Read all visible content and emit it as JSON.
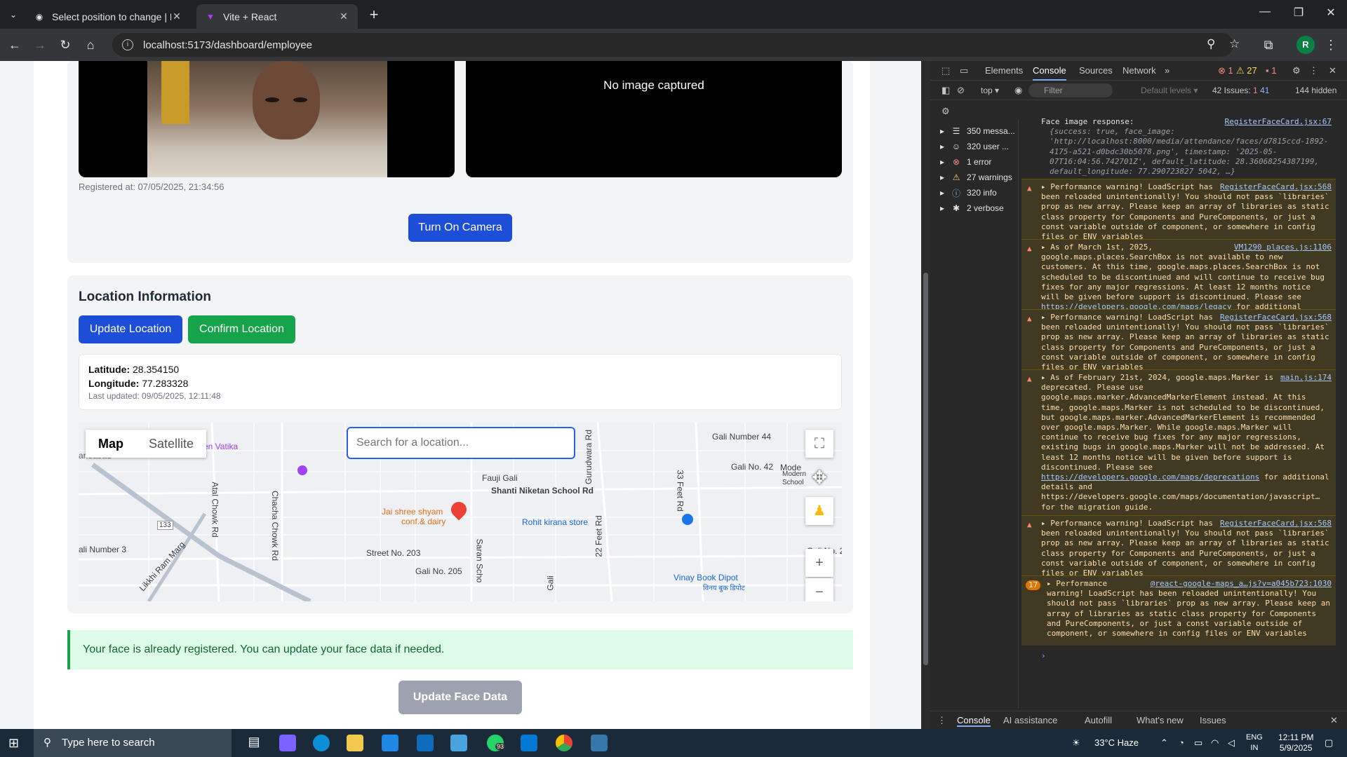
{
  "browser": {
    "tabs": [
      {
        "title": "Select position to change | Djan",
        "active": false
      },
      {
        "title": "Vite + React",
        "active": true
      }
    ],
    "url": "localhost:5173/dashboard/employee",
    "profile_initial": "R"
  },
  "camera": {
    "right_placeholder": "No image captured",
    "registered_at": "Registered at: 07/05/2025, 21:34:56",
    "turn_on_label": "Turn On Camera"
  },
  "location": {
    "title": "Location Information",
    "update_label": "Update Location",
    "confirm_label": "Confirm Location",
    "latitude_label": "Latitude:",
    "latitude_value": "28.354150",
    "longitude_label": "Longitude:",
    "longitude_value": "77.283328",
    "last_updated": "Last updated: 09/05/2025, 12:11:48"
  },
  "map": {
    "type_map": "Map",
    "type_satellite": "Satellite",
    "search_placeholder": "Search for a location...",
    "labels": {
      "gali44": "Gali Number 44",
      "gali42": "Gali No. 42",
      "fauji": "Fauji Gali",
      "shanti": "Shanti Niketan School Rd",
      "jai1": "Jai shree shyam",
      "jai2": "conf.& dairy",
      "rohit": "Rohit kirana store",
      "street203": "Street No. 203",
      "gali205": "Gali No. 205",
      "gali3": "ali Number 3",
      "vinay": "Vinay Book Dipot",
      "vatika": "en Vatika",
      "atal": "Atal Chowk Rd",
      "chacha": "Chacha Chowk Rd",
      "gurudwara": "Gurudwara Rd",
      "saran": "Saran Scho",
      "feet22": "22 Feet Rd",
      "feet33": "33 Feet Rd",
      "likkhi": "Likkhi Ram Marg",
      "route": "133",
      "gali20": "Gali No. 20",
      "mode": "Mode",
      "modern": "Modern",
      "school": "School",
      "gali": "Gali",
      "faridabad": "aridabad",
      "hindi_vinay": "विनय बुक डिपोट"
    }
  },
  "status_alert": "Your face is already registered. You can update your face data if needed.",
  "update_face_label": "Update Face Data",
  "devtools": {
    "tabs": [
      "Elements",
      "Console",
      "Sources",
      "Network"
    ],
    "counts": {
      "errors": "1",
      "warnings": "27",
      "issues_badge": "1"
    },
    "context": "top",
    "filter_placeholder": "Filter",
    "levels": "Default levels",
    "issues_text": "42 Issues:",
    "issues_counts": [
      "1",
      "41"
    ],
    "hidden": "144 hidden",
    "sidebar": [
      {
        "icon": "list-icon",
        "label": "350 messa..."
      },
      {
        "icon": "user-icon",
        "label": "320 user ..."
      },
      {
        "icon": "error-icon",
        "label": "1 error"
      },
      {
        "icon": "warning-icon",
        "label": "27 warnings"
      },
      {
        "icon": "info-icon",
        "label": "320 info"
      },
      {
        "icon": "bug-icon",
        "label": "2 verbose"
      }
    ],
    "face_log": {
      "head": "Face image response:",
      "src": "RegisterFaceCard.jsx:67",
      "body": "{success: true, face_image: 'http://localhost:8000/media/attendance/faces/d7815ccd-1892-4175-a521-d0bdc30b5078.png', timestamp: '2025-05-07T16:04:56.742701Z', default_latitude: 28.36068254387199, default_longitude: 77.290723827 5042, …}"
    },
    "messages": [
      {
        "src": "RegisterFaceCard.jsx:568",
        "text": "Performance warning! LoadScript has been reloaded unintentionally! You should not pass `libraries` prop as new array. Please keep an array of libraries as static class property for Components and PureComponents, or just a const variable outside of component, or somewhere in config files or ENV variables"
      },
      {
        "src": "VM1290 places.js:1106",
        "text": "As of March 1st, 2025, google.maps.places.SearchBox is not available to new customers. At this time, google.maps.places.SearchBox is not scheduled to be discontinued and will continue to receive bug fixes for any major regressions. At least 12 months notice will be given before support is discontinued. Please see ",
        "link": "https://developers.google.com/maps/legacy",
        "tail": " for additional details."
      },
      {
        "src": "RegisterFaceCard.jsx:568",
        "text": "Performance warning! LoadScript has been reloaded unintentionally! You should not pass `libraries` prop as new array. Please keep an array of libraries as static class property for Components and PureComponents, or just a const variable outside of component, or somewhere in config files or ENV variables"
      },
      {
        "src": "main.js:174",
        "text": "As of February 21st, 2024, google.maps.Marker is deprecated. Please use google.maps.marker.AdvancedMarkerElement instead. At this time, google.maps.Marker is not scheduled to be discontinued, but google.maps.marker.AdvancedMarkerElement is recommended over google.maps.Marker. While google.maps.Marker will continue to receive bug fixes for any major regressions, existing bugs in google.maps.Marker will not be addressed. At least 12 months notice will be given before support is discontinued. Please see ",
        "link": "https://developers.google.com/maps/deprecations",
        "tail": " for additional details and https://developers.google.com/maps/documentation/javascript… for the migration guide."
      },
      {
        "src": "RegisterFaceCard.jsx:568",
        "text": "Performance warning! LoadScript has been reloaded unintentionally! You should not pass `libraries` prop as new array. Please keep an array of libraries as static class property for Components and PureComponents, or just a const variable outside of component, or somewhere in config files or ENV variables"
      },
      {
        "badge": "17",
        "src": "@react-google-maps_a…js?v=a045b723:1030",
        "text": "Performance warning! LoadScript has been reloaded unintentionally! You should not pass `libraries` prop as new array. Please keep an array of libraries as static class property for Components and PureComponents, or just a const variable outside of component, or somewhere in config files or ENV variables"
      }
    ],
    "bottom_tabs": [
      "Console",
      "AI assistance",
      "Autofill",
      "What's new",
      "Issues"
    ]
  },
  "taskbar": {
    "search_placeholder": "Type here to search",
    "weather": "33°C  Haze",
    "lang1": "ENG",
    "lang2": "IN",
    "time": "12:11 PM",
    "date": "5/9/2025",
    "whatsapp_badge": "93"
  },
  "colors": {
    "primary": "#1d4ed8",
    "success": "#16a34a",
    "disabled": "#9ca3af"
  }
}
